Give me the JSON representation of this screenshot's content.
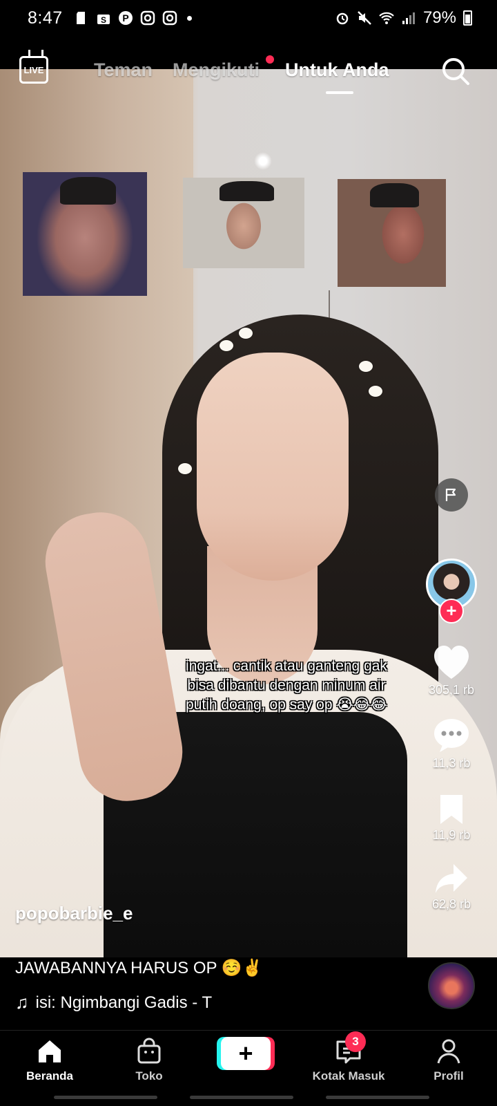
{
  "status_bar": {
    "time": "8:47",
    "battery": "79%"
  },
  "top_nav": {
    "live_label": "LIVE",
    "tabs": [
      "Teman",
      "Mengikuti",
      "Untuk Anda"
    ],
    "active_tab": "Untuk Anda",
    "mengikuti_has_dot": true
  },
  "video": {
    "overlay_text": "ingat... cantik atau ganteng gak bisa dibantu dengan minum air putih doang, op say op 😭😂😂"
  },
  "rail": {
    "likes": "305,1 rb",
    "comments": "11,3 rb",
    "saves": "11,9 rb",
    "shares": "62,8 rb"
  },
  "post": {
    "username": "popobarbie_e",
    "caption": "JAWABANNYA HARUS OP ☺️✌️",
    "music": "isi: Ngimbangi Gadis - T"
  },
  "bottom_nav": {
    "home": "Beranda",
    "shop": "Toko",
    "inbox": "Kotak Masuk",
    "inbox_badge": "3",
    "profile": "Profil"
  },
  "colors": {
    "accent": "#fe2c55",
    "cyan": "#25f4ee"
  }
}
